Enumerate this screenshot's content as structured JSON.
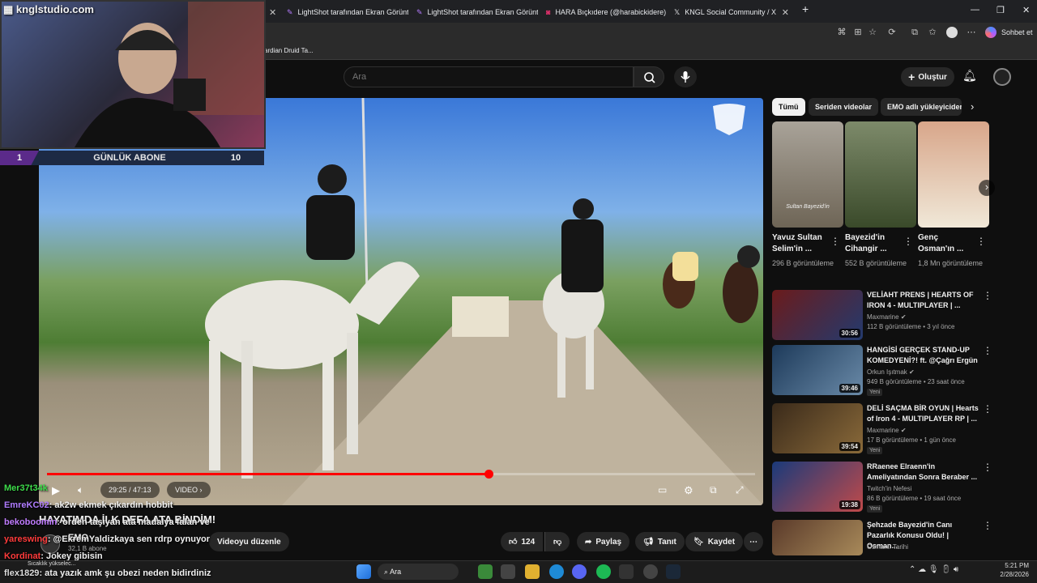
{
  "browser": {
    "tabs": [
      {
        "label": "LightShot tarafından Ekran Görünt"
      },
      {
        "label": "LightShot tarafından Ekran Görünt"
      },
      {
        "label": "HARA Bıçkıdere (@harabickidere)"
      },
      {
        "label": "KNGL Social Community / X"
      }
    ],
    "new_tab": "+",
    "chat_label": "Sohbet et",
    "bookmark": "ardian Druid Ta..."
  },
  "stream_overlay": {
    "watermark": "knglstudio.com",
    "sub_label": "GÜNLÜK ABONE",
    "sub_current": "1",
    "sub_goal": "10"
  },
  "youtube": {
    "search_placeholder": "Ara",
    "create_label": "Oluştur",
    "player": {
      "time": "29:25 / 47:13",
      "chapter": "VIDEO",
      "progress": 0.623
    },
    "title_partial": "HAYATIMDA İLK DEFA ATA BİNDİM!",
    "channel": "EMO",
    "subscribers": "32,1 B abone",
    "edit_label": "Videoyu düzenle",
    "likes": "124",
    "share": "Paylaş",
    "promote": "Tanıt",
    "save": "Kaydet",
    "chips": [
      "Tümü",
      "Seriden videolar",
      "EMO adlı yükleyiciden"
    ],
    "shorts": [
      {
        "title": "Yavuz Sultan Selim'in ...",
        "views": "296 B görüntüleme",
        "overlay": "Sultan Bayezid'in"
      },
      {
        "title": "Bayezid'in Cihangir ...",
        "views": "552 B görüntüleme"
      },
      {
        "title": "Genç Osman'ın ...",
        "views": "1,8 Mn görüntüleme"
      }
    ],
    "recommended": [
      {
        "title": "VELİAHT PRENS | HEARTS OF IRON 4 - MULTIPLAYER | ...",
        "channel": "Maxmarine",
        "meta": "112 B görüntüleme • 3 yıl önce",
        "duration": "30:56",
        "badge": ""
      },
      {
        "title": "HANGİSİ GERÇEK STAND-UP KOMEDYENİ?! ft. @Çağrı Ergün",
        "channel": "Orkun Işıtmak",
        "meta": "949 B görüntüleme • 23 saat önce",
        "duration": "39:46",
        "badge": "Yeni"
      },
      {
        "title": "DELİ SAÇMA BİR OYUN | Hearts of Iron 4 - MULTIPLAYER RP | ...",
        "channel": "Maxmarine",
        "meta": "17 B görüntüleme • 1 gün önce",
        "duration": "39:54",
        "badge": "Yeni"
      },
      {
        "title": "RRaenee Elraenn'in Ameliyatından Sonra Beraber ...",
        "channel": "Twitch'in Nefesi",
        "meta": "86 B görüntüleme • 19 saat önce",
        "duration": "19:38",
        "badge": "Yeni"
      },
      {
        "title": "Şehzade Bayezid'in Canı Pazarlık Konusu Oldu! | Osman...",
        "channel": "Osmanlı Tarihi",
        "meta": "",
        "duration": "",
        "badge": ""
      }
    ]
  },
  "chat": [
    {
      "user": "Mer37t34k",
      "msg": "",
      "color": "#3ddc4a"
    },
    {
      "user": "EmreKC02",
      "msg": ": ak2w ekmek çıkardın hobbit",
      "color": "#b07cff"
    },
    {
      "user": "bekoboomin",
      "msg": ": orden taşıyan ata madalya falan ve",
      "color": "#c07cff"
    },
    {
      "user": "yareswing",
      "msg": ": @EkremYaldizkaya sen rdrp oynuyor",
      "color": "#ff3b3b"
    },
    {
      "user": "Kordinat",
      "msg": ": Jokey gibisin",
      "color": "#ff3b3b"
    },
    {
      "user": "flex1829",
      "msg": ": ata yazık amk şu obezi neden bidirdiniz",
      "color": "#dddddd"
    }
  ],
  "taskbar": {
    "search": "Ara",
    "weather": "Sıcaklık yükselec...",
    "time": "5:21 PM",
    "date": "2/28/2026"
  },
  "colors": {
    "accent": "#ff0000",
    "purple": "#5b2a8a"
  }
}
